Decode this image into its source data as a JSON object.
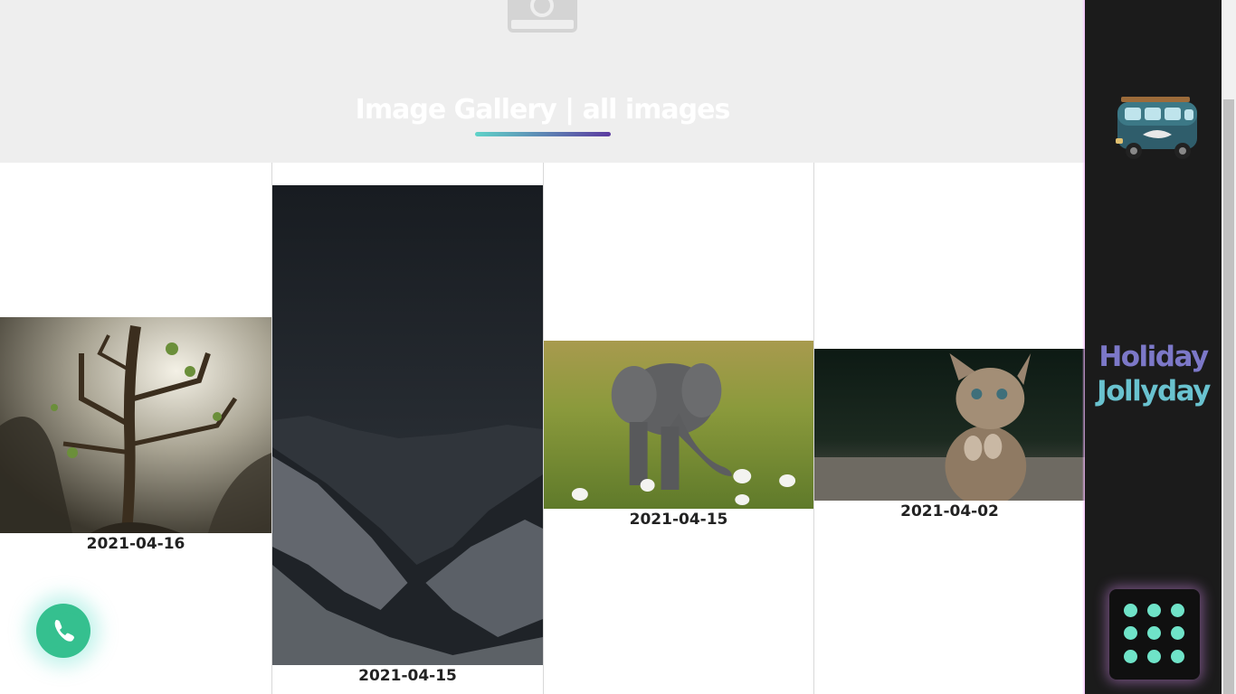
{
  "header": {
    "title": "Image Gallery | all images",
    "camera_icon": "camera-icon",
    "underline_colors": [
      "#5fd3c8",
      "#5b3aa0"
    ]
  },
  "gallery": {
    "items": [
      {
        "date": "2021-04-16",
        "image": "fantasy-tree-with-birds"
      },
      {
        "date": "2021-04-15",
        "image": "dark-snowy-mountains"
      },
      {
        "date": "2021-04-15",
        "image": "baby-elephant-with-egrets"
      },
      {
        "date": "2021-04-02",
        "image": "kitten-praying"
      }
    ]
  },
  "sidebar": {
    "logo_image": "vintage-van-logo",
    "brand_line1": "Holiday",
    "brand_line2": "Jollyday",
    "apps_icon": "apps-grid-icon",
    "accent": "#6fe3c8",
    "glow": "#f3b6ff"
  },
  "floating": {
    "whatsapp_icon": "phone-icon",
    "color": "#35c08f"
  }
}
